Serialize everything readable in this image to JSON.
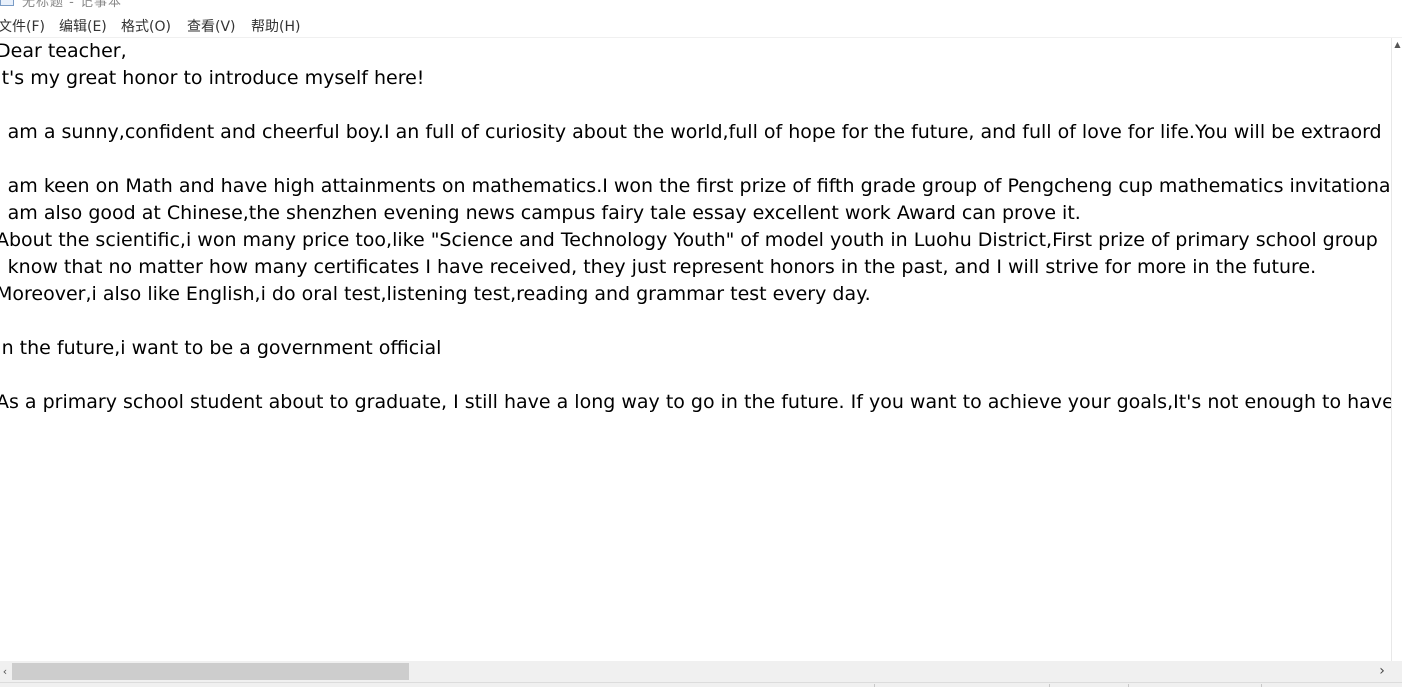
{
  "window": {
    "title": "无标题 - 记事本"
  },
  "menu": {
    "items": [
      {
        "label": "文件(F)"
      },
      {
        "label": "编辑(E)"
      },
      {
        "label": "格式(O)"
      },
      {
        "label": "查看(V)"
      },
      {
        "label": "帮助(H)"
      }
    ]
  },
  "document": {
    "lines": [
      "Dear teacher,",
      "It's my great honor to introduce myself here!",
      "",
      "I am a sunny,confident and cheerful boy.I an full of curiosity about the world,full of hope for the future, and full of love for life.You will be extraord",
      "",
      "I am keen on Math and have high attainments on mathematics.I won the first prize of fifth grade group of Pengcheng cup mathematics invitationa",
      "I am also good at Chinese,the shenzhen evening news campus fairy tale essay excellent work Award can prove it.",
      "About the scientific,i won many price too,like \"Science and Technology Youth\" of model youth in Luohu District,First prize of primary school group",
      "I know that no matter how many certificates I have received, they just represent honors in the past, and I will strive for more in the future.",
      "Moreover,i also like English,i do oral test,listening test,reading and grammar test every day.",
      "",
      "In the future,i want to be a government official",
      "",
      "As a primary school student about to graduate, I still have a long way to go in the future. If you want to achieve your goals,It's not enough to have"
    ]
  },
  "scrollbars": {
    "horizontal_left_icon": "chevron-left-icon",
    "horizontal_right_icon": "chevron-right-icon",
    "vertical_up_icon": "chevron-up-icon"
  }
}
